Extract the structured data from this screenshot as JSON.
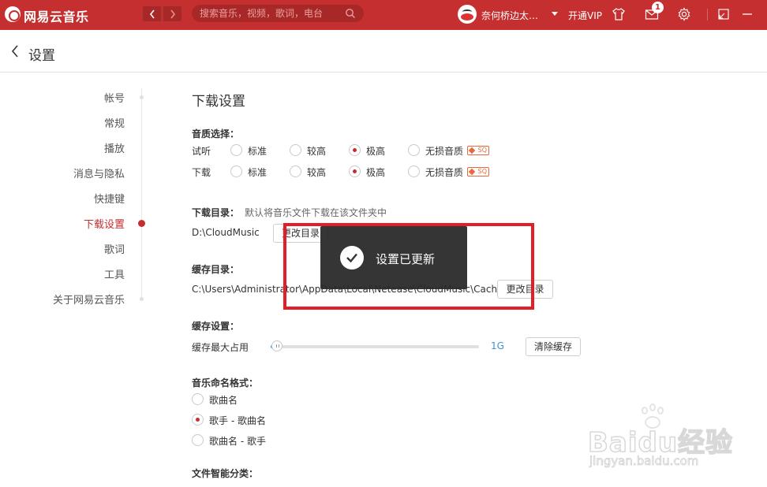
{
  "app": {
    "title": "网易云音乐"
  },
  "search": {
    "placeholder": "搜索音乐，视频，歌词，电台"
  },
  "user": {
    "name": "奈何桥边太…",
    "vip_label": "开通VIP",
    "message_count": "1"
  },
  "header": {
    "title": "设置"
  },
  "nav": {
    "items": [
      "帐号",
      "常规",
      "播放",
      "消息与隐私",
      "快捷键",
      "下载设置",
      "歌词",
      "工具",
      "关于网易云音乐"
    ],
    "active": "下载设置"
  },
  "download": {
    "title": "下载设置",
    "quality": {
      "label": "音质选择：",
      "rows": [
        {
          "label": "试听",
          "selected": "极高"
        },
        {
          "label": "下载",
          "selected": "极高"
        }
      ],
      "options": [
        "标准",
        "较高",
        "极高",
        "无损音质"
      ],
      "sq_badge": "SQ"
    },
    "dir": {
      "label": "下载目录：",
      "hint": "默认将音乐文件下载在该文件夹中",
      "path": "D:\\CloudMusic",
      "button": "更改目录"
    },
    "cache_dir": {
      "label": "缓存目录：",
      "path": "C:\\Users\\Administrator\\AppData\\Local\\Netease\\CloudMusic\\Cache",
      "button": "更改目录"
    },
    "cache": {
      "label": "缓存设置：",
      "max_label": "缓存最大占用",
      "value": "1G",
      "fraction": 0.03,
      "clear_button": "清除缓存"
    },
    "naming": {
      "label": "音乐命名格式：",
      "options": [
        "歌曲名",
        "歌手 - 歌曲名",
        "歌曲名 - 歌手"
      ],
      "selected": "歌手 - 歌曲名"
    },
    "classify": {
      "label": "文件智能分类："
    }
  },
  "toast": {
    "text": "设置已更新"
  },
  "watermark": {
    "brand": "Baidu经验",
    "url": "jingyan.baidu.com"
  },
  "colors": {
    "brand_red": "#c62f2f",
    "accent_blue": "#3a94d2",
    "highlight_red": "#e21e26"
  }
}
